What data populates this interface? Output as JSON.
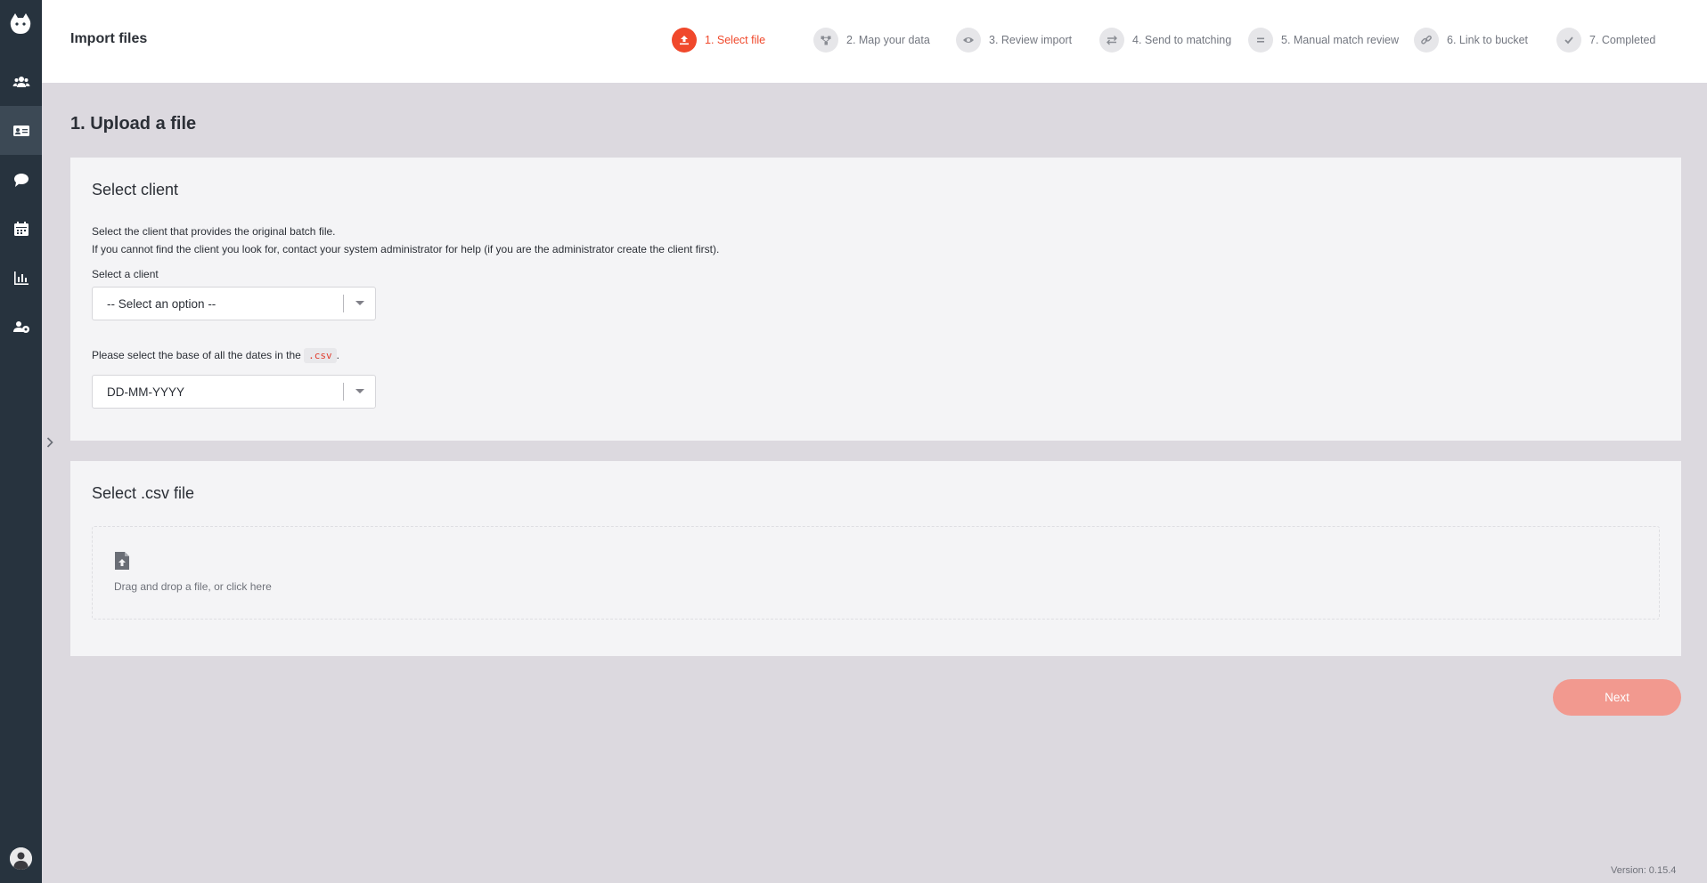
{
  "header": {
    "title": "Import files",
    "steps": [
      {
        "label": "1. Select file",
        "icon": "upload-icon",
        "active": true
      },
      {
        "label": "2. Map your data",
        "icon": "map-icon",
        "active": false
      },
      {
        "label": "3. Review import",
        "icon": "eye-icon",
        "active": false
      },
      {
        "label": "4. Send to matching",
        "icon": "swap-icon",
        "active": false
      },
      {
        "label": "5. Manual match review",
        "icon": "equals-icon",
        "active": false
      },
      {
        "label": "6. Link to bucket",
        "icon": "link-icon",
        "active": false
      },
      {
        "label": "7. Completed",
        "icon": "check-icon",
        "active": false
      }
    ]
  },
  "sidebar": {
    "items": [
      {
        "icon": "users-icon"
      },
      {
        "icon": "id-card-icon",
        "active": true
      },
      {
        "icon": "chat-icon"
      },
      {
        "icon": "calendar-icon"
      },
      {
        "icon": "bar-chart-icon"
      },
      {
        "icon": "user-group-icon"
      }
    ]
  },
  "main": {
    "title": "1. Upload a file",
    "client_card": {
      "title": "Select client",
      "desc_line1": "Select the client that provides the original batch file.",
      "desc_line2": "If you cannot find the client you look for, contact your system administrator for help (if you are the administrator create the client first).",
      "client_label": "Select a client",
      "client_value": "-- Select an option --",
      "date_label_prefix": "Please select the base of all the dates in the",
      "date_label_code": ".csv",
      "date_label_suffix": ".",
      "date_value": "DD-MM-YYYY"
    },
    "file_card": {
      "title": "Select .csv file",
      "dropzone_hint": "Drag and drop a file, or click here"
    },
    "next_label": "Next"
  },
  "footer": {
    "version": "Version: 0.15.4"
  },
  "colors": {
    "accent": "#f0482b",
    "sidebar": "#27333e",
    "background": "#dcd9df"
  }
}
